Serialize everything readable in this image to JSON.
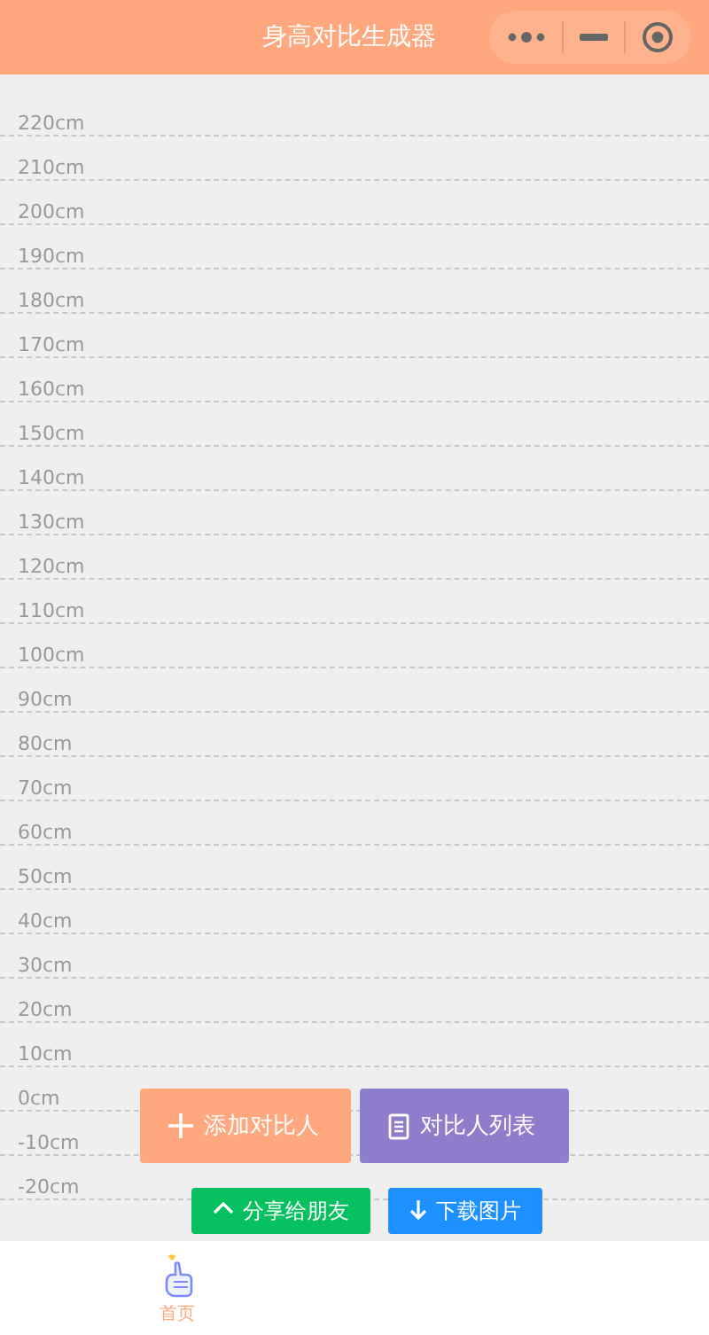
{
  "nav_bar": {
    "title": "身高对比生成器"
  },
  "ruler": {
    "marks": [
      "220cm",
      "210cm",
      "200cm",
      "190cm",
      "180cm",
      "170cm",
      "160cm",
      "150cm",
      "140cm",
      "130cm",
      "120cm",
      "110cm",
      "100cm",
      "90cm",
      "80cm",
      "70cm",
      "60cm",
      "50cm",
      "40cm",
      "30cm",
      "20cm",
      "10cm",
      "0cm",
      "-10cm",
      "-20cm"
    ]
  },
  "actions": [
    {
      "kind": "add",
      "label": "添加对比人"
    },
    {
      "kind": "list",
      "label": "对比人列表"
    }
  ],
  "share_actions": [
    {
      "kind": "share",
      "label": "分享给朋友"
    },
    {
      "kind": "download",
      "label": "下载图片"
    }
  ],
  "tab_bar": [
    {
      "label": "首页",
      "selected": true
    }
  ]
}
